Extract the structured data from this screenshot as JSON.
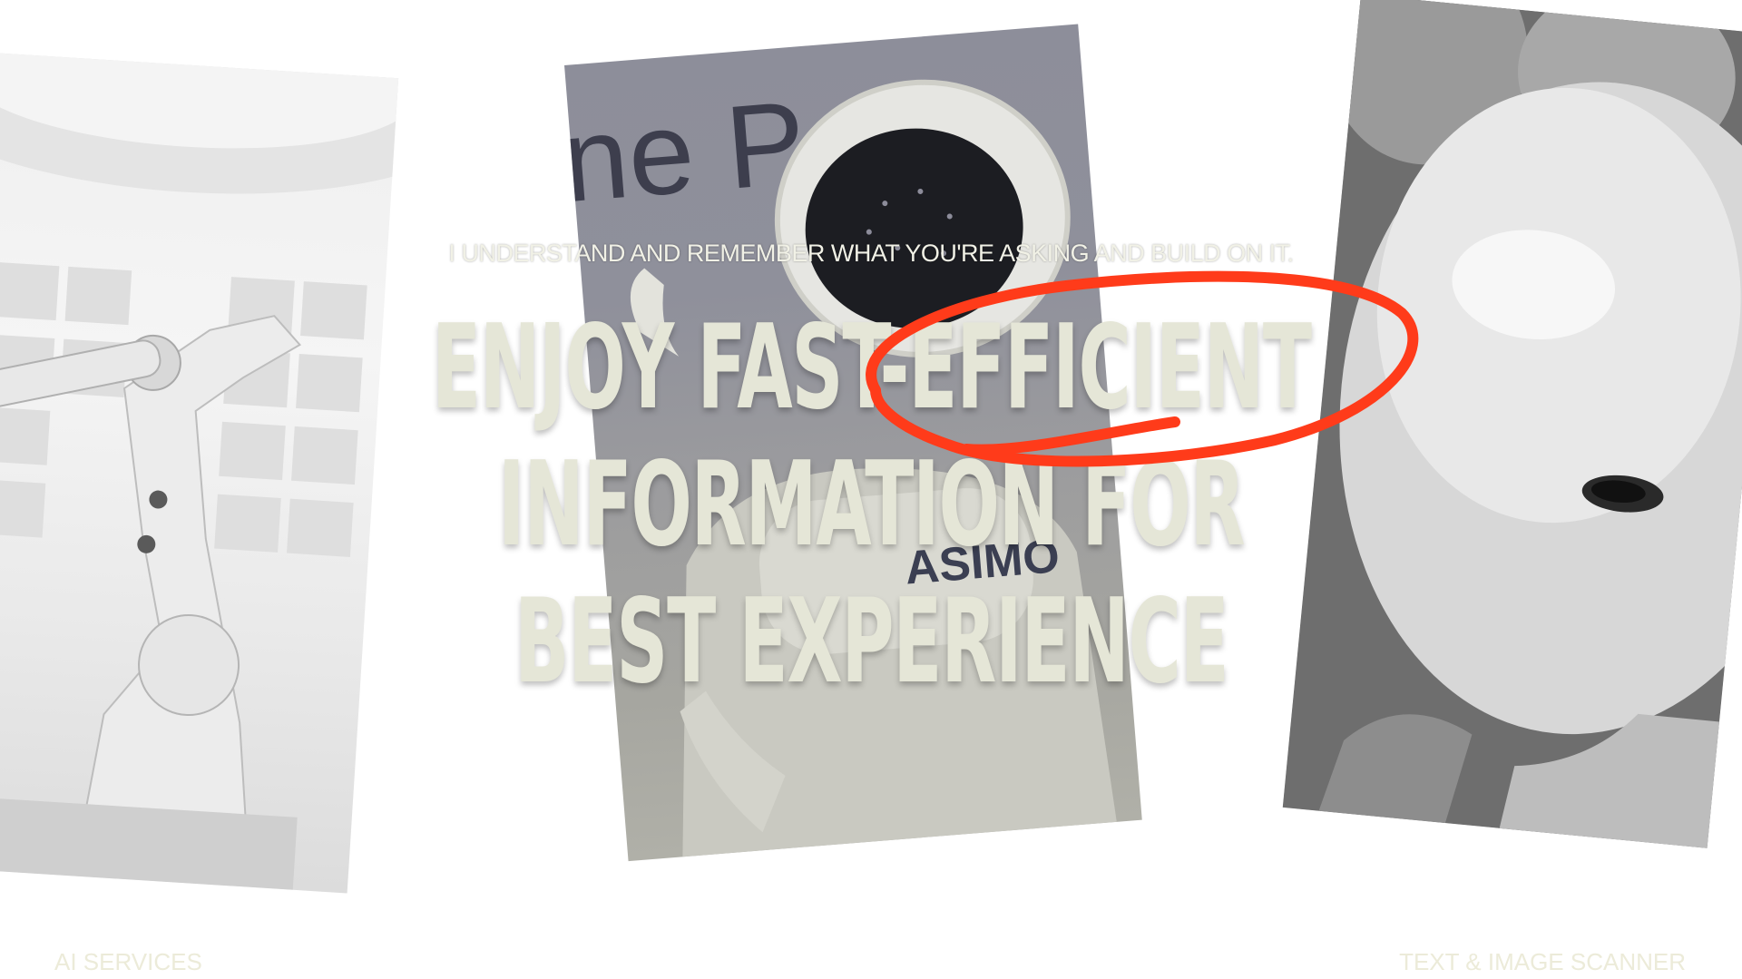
{
  "hero": {
    "kicker": "I UNDERSTAND AND REMEMBER WHAT YOU'RE ASKING AND BUILD ON IT.",
    "headline_lines": [
      "ENJOY FAST-EFFICIENT",
      "INFORMATION FOR",
      "BEST EXPERIENCE"
    ],
    "highlight_word": "EFFICIENT",
    "highlight_color": "#ff3b1a"
  },
  "images": {
    "left": "industrial-robot-arm",
    "middle": "humanoid-robot-asimo",
    "middle_sign_text": "ASIMO",
    "middle_bg_text": "ne Po",
    "right": "humanoid-robot-face"
  },
  "footer": {
    "left_label": "AI SERVICES",
    "right_label": "TEXT & IMAGE SCANNER"
  },
  "colors": {
    "headline": "#e5e6d7",
    "footer_text": "#ecebd9",
    "background": "#ffffff"
  }
}
